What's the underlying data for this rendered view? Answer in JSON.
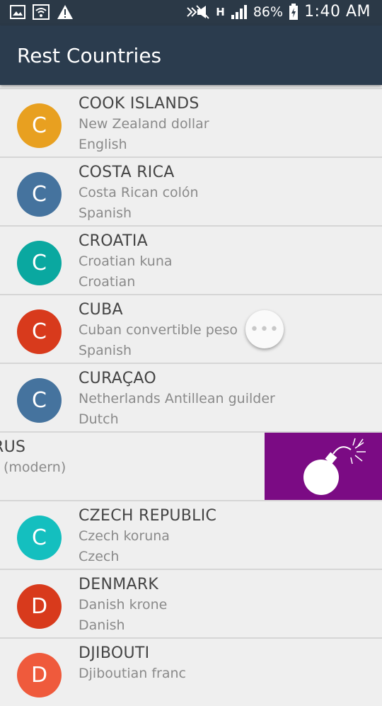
{
  "status_bar": {
    "battery": "86%",
    "time": "1:40 AM",
    "network": "H",
    "icons": [
      "image-icon",
      "wifi-icon",
      "warning-icon",
      "mute-icon",
      "signal-icon",
      "battery-icon"
    ]
  },
  "app_bar": {
    "title": "Rest Countries"
  },
  "more_button": {
    "glyph": "•••"
  },
  "countries": [
    {
      "initial": "C",
      "name": "COOK ISLANDS",
      "currency": "New Zealand dollar",
      "language": "English",
      "color": "#e8a020"
    },
    {
      "initial": "C",
      "name": "COSTA RICA",
      "currency": "Costa Rican colón",
      "language": "Spanish",
      "color": "#45739e"
    },
    {
      "initial": "C",
      "name": "CROATIA",
      "currency": "Croatian kuna",
      "language": "Croatian",
      "color": "#0aa8a0"
    },
    {
      "initial": "C",
      "name": "CUBA",
      "currency": "Cuban convertible peso",
      "language": "Spanish",
      "color": "#d83a1c"
    },
    {
      "initial": "C",
      "name": "CURAÇAO",
      "currency": "Netherlands Antillean guilder",
      "language": "Dutch",
      "color": "#45739e"
    },
    {
      "initial": "",
      "name": "RUS",
      "currency": "",
      "language": "(modern)",
      "color": "#7b0b84"
    },
    {
      "initial": "C",
      "name": "CZECH REPUBLIC",
      "currency": "Czech koruna",
      "language": "Czech",
      "color": "#14bfbf"
    },
    {
      "initial": "D",
      "name": "DENMARK",
      "currency": "Danish krone",
      "language": "Danish",
      "color": "#d83a1c"
    },
    {
      "initial": "D",
      "name": "DJIBOUTI",
      "currency": "Djiboutian franc",
      "language": "",
      "color": "#ef5a3c"
    }
  ]
}
